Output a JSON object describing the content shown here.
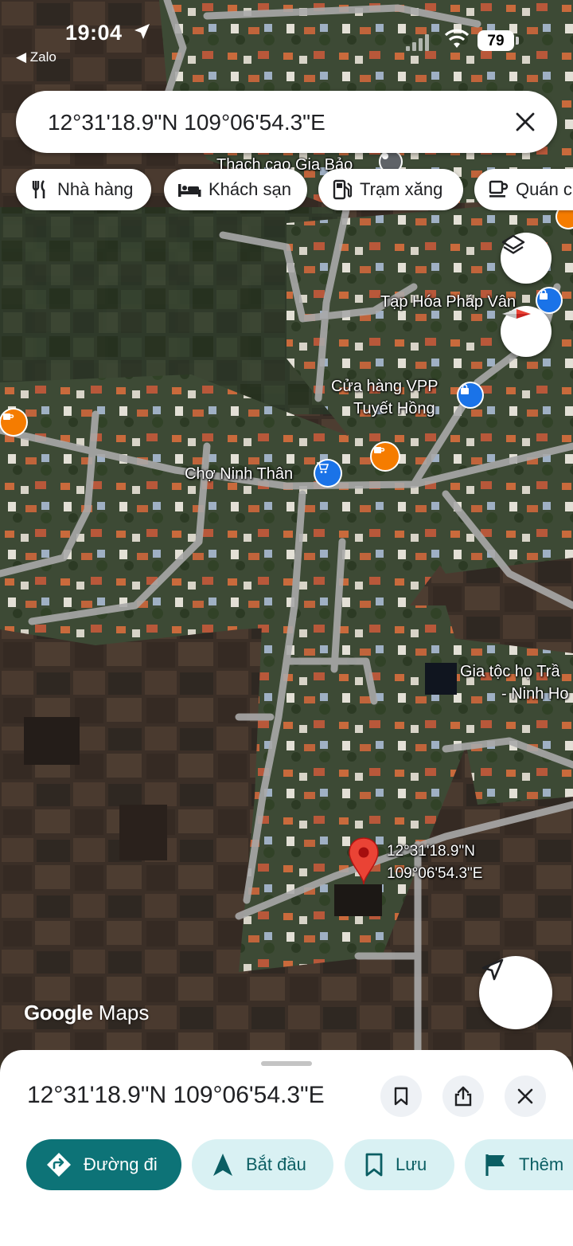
{
  "status_bar": {
    "time": "19:04",
    "back_app": "◀ Zalo",
    "battery": "79"
  },
  "search": {
    "query": "12°31'18.9\"N 109°06'54.3\"E"
  },
  "chips": [
    {
      "label": "Nhà hàng",
      "icon": "restaurant-icon"
    },
    {
      "label": "Khách sạn",
      "icon": "hotel-icon"
    },
    {
      "label": "Trạm xăng",
      "icon": "gas-station-icon"
    },
    {
      "label": "Quán c",
      "icon": "cafe-icon"
    }
  ],
  "map": {
    "labels": {
      "top_poi": "Thạch cao Gia Bảo",
      "grocery": "Tạp Hóa Pháp Vân",
      "stationery_1": "Cửa hàng VPP",
      "stationery_2": "Tuyết Hồng",
      "market": "Chợ Ninh Thân",
      "family_1": "Gia tộc họ Trầ",
      "family_2": "- Ninh Ho",
      "pin_lat": "12°31'18.9\"N",
      "pin_lng": "109°06'54.3\"E"
    },
    "branding": {
      "google": "Google",
      "maps": "Maps"
    },
    "colors": {
      "pin": "#ea4335",
      "shop_poi": "#1a73e8",
      "food_poi": "#f57c00",
      "road": "#a9a9a9"
    }
  },
  "sheet": {
    "title": "12°31'18.9\"N 109°06'54.3\"E",
    "actions": [
      {
        "label": "Đường đi",
        "icon": "directions-icon"
      },
      {
        "label": "Bắt đầu",
        "icon": "navigation-arrow-icon"
      },
      {
        "label": "Lưu",
        "icon": "bookmark-icon"
      },
      {
        "label": "Thêm",
        "icon": "flag-icon"
      }
    ]
  }
}
